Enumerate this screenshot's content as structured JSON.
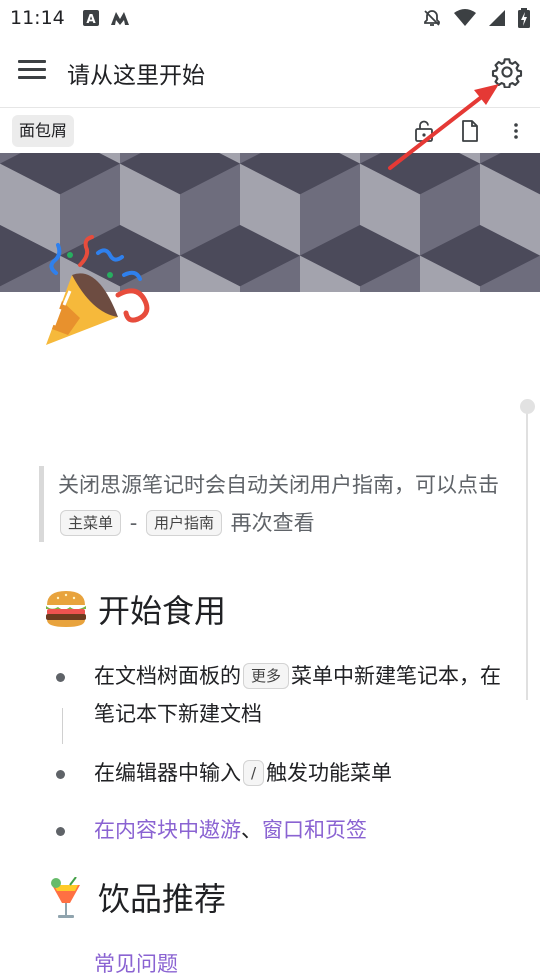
{
  "status_bar": {
    "time": "11:14",
    "icons": [
      "text-notification-icon",
      "app-notification-icon",
      "alarm-off-icon",
      "wifi-icon",
      "signal-icon",
      "battery-charging-icon"
    ]
  },
  "toolbar": {
    "title": "请从这里开始",
    "menu_icon": "hamburger-menu-icon",
    "settings_icon": "gear-icon"
  },
  "breadcrumb": {
    "label": "面包屑",
    "actions": [
      "unlock-icon",
      "document-icon",
      "more-vertical-icon"
    ]
  },
  "annotation": {
    "arrow_color": "#e53935"
  },
  "document": {
    "icon": "party-popper-emoji",
    "quote": {
      "text_before": "关闭思源笔记时会自动关闭用户指南，可以点击",
      "kbd1": "主菜单",
      "separator": " - ",
      "kbd2": "用户指南",
      "text_after": "再次查看"
    },
    "section1": {
      "emoji": "hamburger-emoji",
      "heading": "开始食用",
      "items": [
        {
          "before": "在文档树面板的",
          "kbd": "更多",
          "after": "菜单中新建笔记本，在笔记本下新建文档"
        },
        {
          "before": "在编辑器中输入",
          "kbd": "/",
          "after": "触发功能菜单"
        },
        {
          "link1": "在内容块中遨游",
          "sep": "、",
          "link2": "窗口和页签"
        }
      ]
    },
    "section2": {
      "emoji": "tropical-drink-emoji",
      "heading": "饮品推荐",
      "first_item_partial": "常见问题"
    }
  },
  "colors": {
    "link": "#8a63d2",
    "banner_dark": "#4b4a5a",
    "banner_light": "#a3a3ad"
  }
}
